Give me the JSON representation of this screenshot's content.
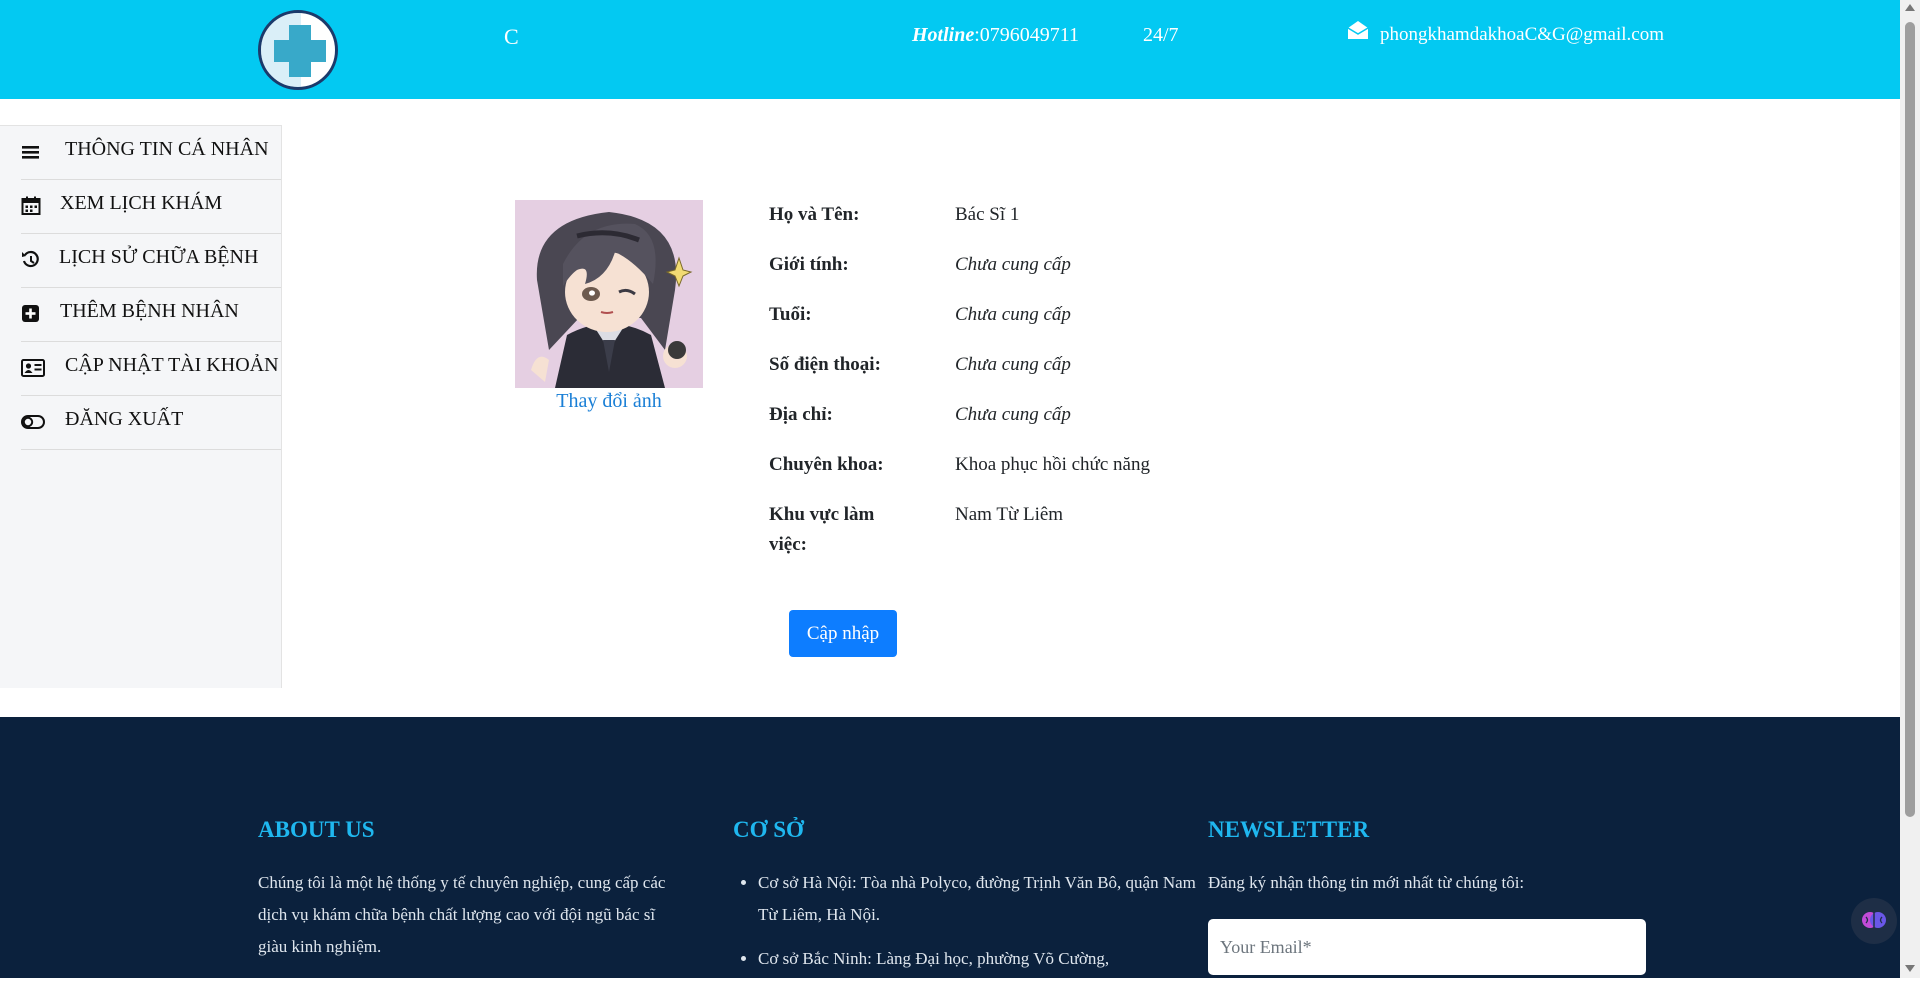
{
  "header": {
    "logo": "plus-cross-logo",
    "fragment": "C",
    "hotline_label": "Hotline",
    "hotline_number": ":0796049711",
    "hours": "24/7",
    "email": "phongkhamdakhoaC&G@gmail.com",
    "color": "#03c9f2"
  },
  "sidebar": {
    "items": [
      {
        "label": "THÔNG TIN CÁ NHÂN",
        "icon": "bars-icon"
      },
      {
        "label": "XEM LỊCH KHÁM",
        "icon": "calendar-icon"
      },
      {
        "label": "LỊCH SỬ CHỮA BỆNH",
        "icon": "history-icon"
      },
      {
        "label": "THÊM BỆNH NHÂN",
        "icon": "plus-square-icon"
      },
      {
        "label": "CẬP NHẬT TÀI KHOẢN",
        "icon": "id-card-icon"
      },
      {
        "label": "ĐĂNG XUẤT",
        "icon": "toggle-icon"
      }
    ]
  },
  "profile": {
    "change_photo": "Thay đổi ảnh",
    "fields": [
      {
        "label": "Họ và Tên:",
        "value": "Bác Sĩ 1"
      },
      {
        "label": "Giới tính:",
        "value": "Chưa cung cấp"
      },
      {
        "label": "Tuổi:",
        "value": "Chưa cung cấp"
      },
      {
        "label": "Số điện thoại:",
        "value": "Chưa cung cấp"
      },
      {
        "label": "Địa chỉ:",
        "value": "Chưa cung cấp"
      },
      {
        "label": "Chuyên khoa:",
        "value": "Khoa phục hồi chức năng"
      },
      {
        "label": "Khu vực làm việc:",
        "value": "Nam Từ Liêm"
      }
    ],
    "update_button": "Cập nhập",
    "button_color": "#0d7dff"
  },
  "footer": {
    "about_title": "ABOUT US",
    "about_text": "Chúng tôi là một hệ thống y tế chuyên nghiệp, cung cấp các dịch vụ khám chữa bệnh chất lượng cao với đội ngũ bác sĩ giàu kinh nghiệm.",
    "branches_title": "CƠ SỞ",
    "branches": [
      "Cơ sở Hà Nội: Tòa nhà Polyco, đường Trịnh Văn Bô, quận Nam Từ Liêm, Hà Nội.",
      "Cơ sở Bắc Ninh: Làng Đại học, phường Võ Cường,"
    ],
    "newsletter_title": "NEWSLETTER",
    "newsletter_text": "Đăng ký nhận thông tin mới nhất từ chúng tôi:",
    "email_placeholder": "Your Email*",
    "background": "#0b213d",
    "title_color": "#1fb7ef"
  }
}
